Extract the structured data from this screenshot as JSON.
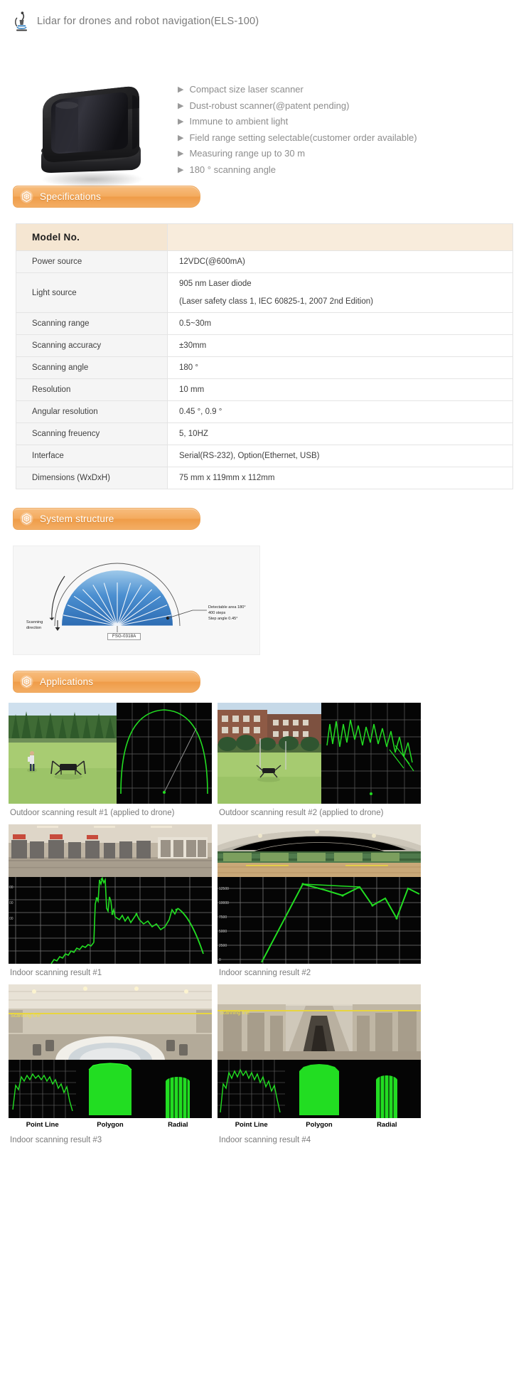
{
  "title": {
    "text": "Lidar for drones and robot navigation(ELS-100)",
    "icon": "microscope-icon"
  },
  "hero": {
    "product_image_alt": "ELS-100 lidar scanner device",
    "bullet_marker": "▶",
    "bullets": [
      "Compact size laser scanner",
      "Dust-robust scanner(@patent pending)",
      "Immune to ambient light",
      "Field range setting selectable(customer order available)",
      "Measuring range up to 30 m",
      "180 °  scanning angle"
    ]
  },
  "sections": {
    "specifications": {
      "label": "Specifications",
      "icon": "hexagon-mesh-icon"
    },
    "system_structure": {
      "label": "System structure",
      "icon": "hexagon-mesh-icon"
    },
    "applications": {
      "label": "Applications",
      "icon": "hexagon-mesh-icon"
    }
  },
  "spec_table": {
    "header": {
      "key": "Model No.",
      "value": ""
    },
    "rows": [
      {
        "key": "Power source",
        "value": "12VDC(@600mA)",
        "value2": ""
      },
      {
        "key": "Light source",
        "value": "905 nm Laser diode",
        "value2": "(Laser safety class 1, IEC 60825-1, 2007 2nd Edition)"
      },
      {
        "key": "Scanning range",
        "value": "0.5~30m",
        "value2": ""
      },
      {
        "key": "Scanning accuracy",
        "value": "±30mm",
        "value2": ""
      },
      {
        "key": "Scanning angle",
        "value": "180 °",
        "value2": ""
      },
      {
        "key": "Resolution",
        "value": "10 mm",
        "value2": ""
      },
      {
        "key": "Angular resolution",
        "value": "0.45 °, 0.9 °",
        "value2": ""
      },
      {
        "key": "Scanning freuency",
        "value": "5, 10HZ",
        "value2": ""
      },
      {
        "key": "Interface",
        "value": "Serial(RS-232), Option(Ethernet, USB)",
        "value2": ""
      },
      {
        "key": "Dimensions (WxDxH)",
        "value": "75 mm x 119mm x 112mm",
        "value2": ""
      }
    ]
  },
  "diagram": {
    "scanning_direction_label_line1": "Scanning",
    "scanning_direction_label_line2": "direction",
    "annotation_line1": "Detectable area 180°",
    "annotation_line2": "400 steps",
    "annotation_line3": "Step angle 0.45°",
    "device_label": "FSG-0318A",
    "fan_color_outer": "#2e6db4",
    "fan_color_inner": "#a9cdeb"
  },
  "applications": {
    "items": [
      {
        "caption": "Outdoor scanning result #1 (applied to drone)",
        "type": "photo-plot"
      },
      {
        "caption": "Outdoor scanning result #2 (applied to drone)",
        "type": "photo-plot"
      },
      {
        "caption": "Indoor scanning result #1",
        "type": "photo-over-plot"
      },
      {
        "caption": "Indoor scanning result #2",
        "type": "photo-over-plot"
      },
      {
        "caption": "Indoor scanning result #3",
        "type": "photo-triple-plot"
      },
      {
        "caption": "Indoor scanning result #4",
        "type": "photo-triple-plot"
      }
    ],
    "plot_legend": [
      "Point Line",
      "Polygon",
      "Radial"
    ],
    "scanning_line_label": "Scanning line",
    "plot_axis_labels_indoor1": [
      "00",
      "00",
      "00"
    ],
    "plot_axis_labels_indoor2": [
      "12500",
      "10000",
      "7500",
      "5000",
      "2500",
      "0"
    ],
    "trace_color": "#22dd22",
    "grid_color": "#8a8a8a"
  }
}
